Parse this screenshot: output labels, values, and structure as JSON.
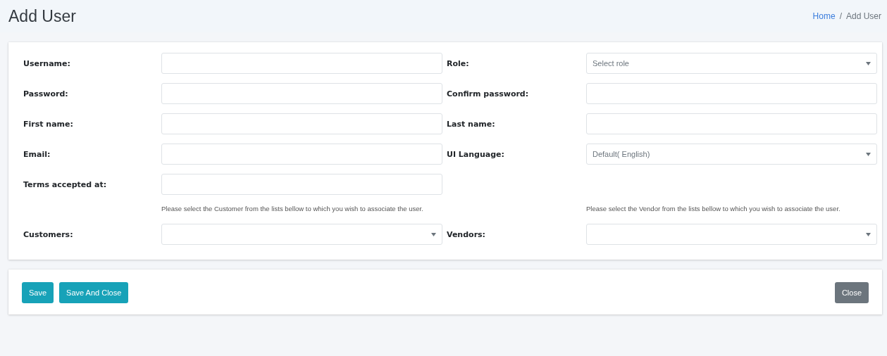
{
  "page_title": "Add User",
  "breadcrumb": [
    {
      "label": "Home",
      "kind": "link"
    },
    {
      "label": "/",
      "kind": "separator"
    },
    {
      "label": "Add User",
      "kind": "current"
    }
  ],
  "rows": [
    {
      "left": {
        "label": "Username:",
        "kind": "text"
      },
      "right": {
        "label": "Role:",
        "kind": "select",
        "placeholder": "Select role"
      }
    },
    {
      "left": {
        "label": "Password:",
        "kind": "text"
      },
      "right": {
        "label": "Confirm password:",
        "kind": "text"
      }
    },
    {
      "left": {
        "label": "First name:",
        "kind": "text"
      },
      "right": {
        "label": "Last name:",
        "kind": "text"
      }
    },
    {
      "left": {
        "label": "Email:",
        "kind": "text"
      },
      "right": {
        "label": "UI Language:",
        "kind": "select",
        "value": "Default( English)"
      }
    },
    {
      "left": {
        "label": "Terms accepted at:",
        "kind": "text"
      }
    }
  ],
  "hints": [
    "Please select the Customer from the lists bellow to which you wish to associate the user.",
    "Please select the Vendor from the lists bellow to which you wish to associate the user."
  ],
  "association_row": {
    "left": {
      "label": "Customers:",
      "kind": "select"
    },
    "right": {
      "label": "Vendors:",
      "kind": "select"
    }
  },
  "footer_buttons": [
    {
      "label": "Save",
      "kind": "primary"
    },
    {
      "label": "Save And Close",
      "kind": "primary"
    },
    {
      "label": "Close",
      "kind": "secondary"
    }
  ]
}
